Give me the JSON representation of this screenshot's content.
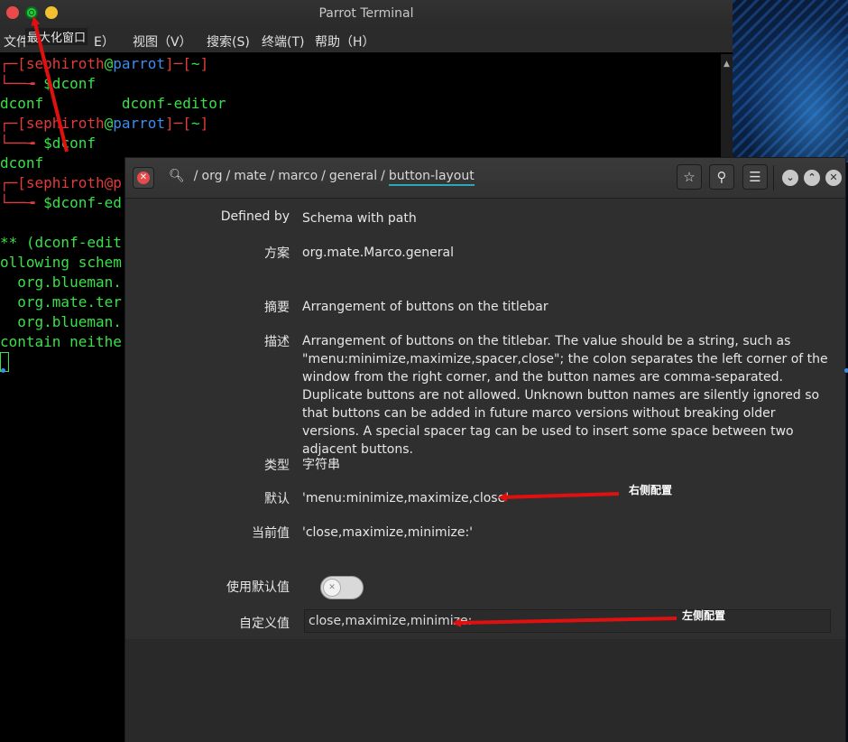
{
  "terminal": {
    "title": "Parrot Terminal",
    "tooltip": "最大化窗口",
    "menu": [
      "文件",
      "E）",
      "视图（V）",
      "搜索(S)",
      "终端(T)",
      "帮助（H）"
    ],
    "lines": [
      {
        "type": "prompt",
        "user": "sephiroth",
        "host": "parrot",
        "dir": "~"
      },
      {
        "type": "cmd",
        "text": "$dconf"
      },
      {
        "type": "out",
        "text": "dconf         dconf-editor"
      },
      {
        "type": "prompt",
        "user": "sephiroth",
        "host": "parrot",
        "dir": "~"
      },
      {
        "type": "cmd",
        "text": "$dconf"
      },
      {
        "type": "out",
        "text": "dconf"
      },
      {
        "type": "prompt_partial",
        "text": "sephiroth@p"
      },
      {
        "type": "cmd",
        "text": "$dconf-ed"
      },
      {
        "type": "blank",
        "text": ""
      },
      {
        "type": "out",
        "text": "** (dconf-edit"
      },
      {
        "type": "out",
        "text": "ollowing schem"
      },
      {
        "type": "out",
        "text": "  org.blueman."
      },
      {
        "type": "out",
        "text": "  org.mate.ter"
      },
      {
        "type": "out",
        "text": "  org.blueman."
      },
      {
        "type": "out",
        "text": "contain neithe"
      }
    ]
  },
  "dconf": {
    "path": {
      "segments": [
        "org",
        "mate",
        "marco",
        "general"
      ],
      "current": "button-layout",
      "root": "/"
    },
    "header_icons": {
      "bookmark": "star-icon",
      "search": "search-icon",
      "menu": "hamburger-icon"
    },
    "fields": {
      "defined_by": {
        "label": "Defined by",
        "value": "Schema with path"
      },
      "schema": {
        "label": "方案",
        "value": "org.mate.Marco.general"
      },
      "summary": {
        "label": "摘要",
        "value": "Arrangement of buttons on the titlebar"
      },
      "description": {
        "label": "描述",
        "value": "Arrangement of buttons on the titlebar. The value should be a string, such as \"menu:minimize,maximize,spacer,close\"; the colon separates the left corner of the window from the right corner, and the button names are comma-separated. Duplicate buttons are not allowed. Unknown button names are silently ignored so that buttons can be added in future marco versions without breaking older versions. A special spacer tag can be used to insert some space between two adjacent buttons."
      },
      "type": {
        "label": "类型",
        "value": "字符串"
      },
      "default": {
        "label": "默认",
        "value": "'menu:minimize,maximize,close'"
      },
      "current": {
        "label": "当前值",
        "value": "'close,maximize,minimize:'"
      },
      "use_default": {
        "label": "使用默认值",
        "checked": false
      },
      "custom": {
        "label": "自定义值",
        "value": "close,maximize,minimize:"
      }
    }
  },
  "annotations": {
    "right_side": "右侧配置",
    "left_side": "左侧配置"
  },
  "colors": {
    "arrow": "#e01010",
    "terminal_green": "#3ae04a",
    "prompt_red": "#e33b3b",
    "host_blue": "#3a8ef0"
  }
}
